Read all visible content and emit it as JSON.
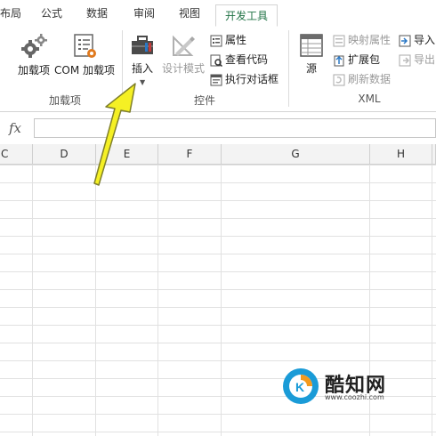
{
  "tabs": [
    {
      "label": "布局",
      "visible_text": "布局"
    },
    {
      "label": "公式"
    },
    {
      "label": "数据"
    },
    {
      "label": "审阅"
    },
    {
      "label": "视图"
    },
    {
      "label": "开发工具",
      "active": true
    }
  ],
  "ribbon": {
    "addins_group": {
      "label": "加载项",
      "buttons": [
        {
          "label": "加载项",
          "icon": "gear-icon"
        },
        {
          "label": "COM 加载项",
          "icon": "com-addin-icon"
        }
      ]
    },
    "controls_group": {
      "label": "控件",
      "insert_label": "插入",
      "design_mode_label": "设计模式",
      "small_buttons": [
        {
          "label": "属性",
          "icon": "properties-icon"
        },
        {
          "label": "查看代码",
          "icon": "view-code-icon"
        },
        {
          "label": "执行对话框",
          "icon": "run-dialog-icon"
        }
      ]
    },
    "xml_group": {
      "label": "XML",
      "source_label": "源",
      "small_buttons": [
        {
          "label": "映射属性",
          "icon": "map-properties-icon",
          "disabled": true
        },
        {
          "label": "扩展包",
          "icon": "expansion-pack-icon",
          "disabled": false
        },
        {
          "label": "刷新数据",
          "icon": "refresh-data-icon",
          "disabled": true
        }
      ],
      "right_buttons": [
        {
          "label": "导入",
          "icon": "import-icon"
        },
        {
          "label": "导出",
          "icon": "export-icon"
        }
      ]
    }
  },
  "formula_bar": {
    "fx_label": "fx",
    "value": ""
  },
  "columns": [
    "C",
    "D",
    "E",
    "F",
    "G",
    "H"
  ],
  "watermark": {
    "title": "酷知网",
    "url": "www.coozhi.com"
  },
  "colors": {
    "accent": "#217346",
    "arrow": "#f5f024",
    "arrow_outline": "#8a8a2a",
    "watermark_blue": "#1a9bd7",
    "watermark_orange": "#f39a1e"
  }
}
